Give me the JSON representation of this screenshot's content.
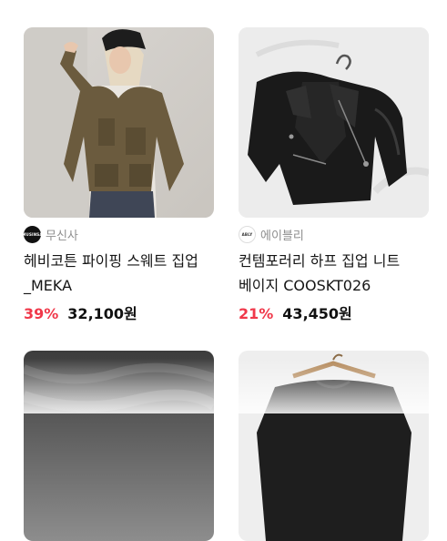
{
  "products": [
    {
      "store": "무신사",
      "store_logo_text": "MUSINSA",
      "title": "헤비코튼 파이핑 스웨트 집업_MEKA",
      "discount": "39%",
      "price": "32,100원"
    },
    {
      "store": "에이블리",
      "store_logo_text": "ABLY",
      "title": "컨템포러리 하프 집업 니트 베이지 COOSKT026",
      "discount": "21%",
      "price": "43,450원"
    }
  ],
  "colors": {
    "discount": "#f0384a",
    "store_text": "#8e8e8e"
  }
}
